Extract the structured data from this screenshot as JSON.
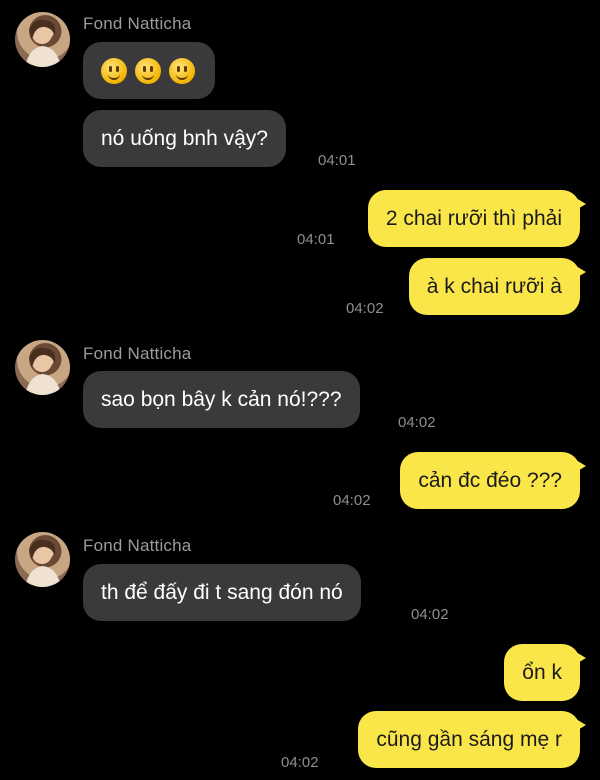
{
  "contact": {
    "name": "Fond Natticha"
  },
  "messages": [
    {
      "text": "🙂🙂🙂",
      "time": ""
    },
    {
      "text": "nó uống bnh vậy?",
      "time": "04:01"
    },
    {
      "text": "2 chai rưỡi thì phải",
      "time": "04:01"
    },
    {
      "text": "à k chai rưỡi à",
      "time": "04:02"
    },
    {
      "text": "sao bọn bây k cản nó!???",
      "time": "04:02"
    },
    {
      "text": "cản đc đéo ???",
      "time": "04:02"
    },
    {
      "text": "th để đấy đi t sang đón nó",
      "time": "04:02"
    },
    {
      "text": "ổn k",
      "time": ""
    },
    {
      "text": "cũng gần sáng mẹ r",
      "time": "04:02"
    }
  ],
  "colors": {
    "background": "#000000",
    "incoming_bubble": "#3a3a3c",
    "outgoing_bubble": "#fbe64a",
    "timestamp": "#8e8e8e",
    "sender_name": "#9b9b9b"
  }
}
